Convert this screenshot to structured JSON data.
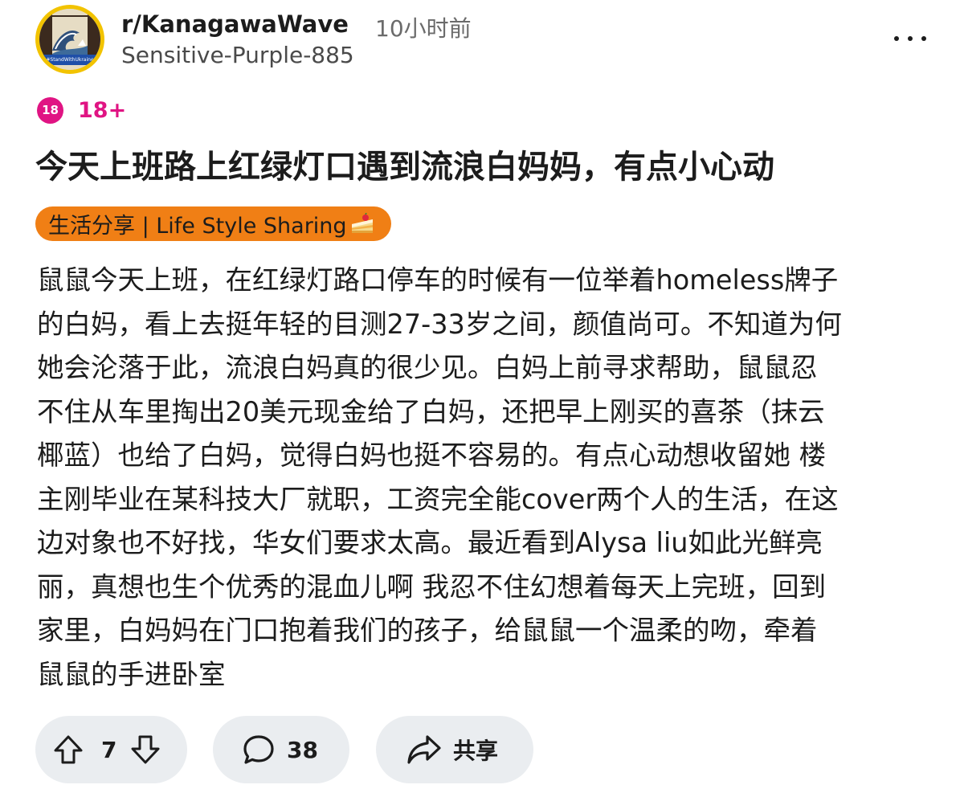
{
  "header": {
    "subreddit": "r/KanagawaWave",
    "time": "10小时前",
    "username": "Sensitive-Purple-885",
    "avatar_banner": "#StandWithUkraine"
  },
  "tags": {
    "nsfw_badge": "18",
    "nsfw_label": "18+"
  },
  "post": {
    "title": "今天上班路上红绿灯口遇到流浪白妈妈，有点小心动",
    "flair": "生活分享 | Life Style Sharing",
    "flair_icon": "cake-icon",
    "body_lines": [
      "鼠鼠今天上班，在红绿灯路口停车的时候有一位举着homeless牌子",
      "的白妈，看上去挺年轻的目测27-33岁之间，颜值尚可。不知道为何",
      "她会沦落于此，流浪白妈真的很少见。白妈上前寻求帮助，鼠鼠忍",
      "不住从车里掏出20美元现金给了白妈，还把早上刚买的喜茶（抹云",
      "椰蓝）也给了白妈，觉得白妈也挺不容易的。有点心动想收留她 楼",
      "主刚毕业在某科技大厂就职，工资完全能cover两个人的生活，在这",
      "边对象也不好找，华女们要求太高。最近看到Alysa liu如此光鲜亮",
      "丽，真想也生个优秀的混血儿啊 我忍不住幻想着每天上完班，回到",
      "家里，白妈妈在门口抱着我们的孩子，给鼠鼠一个温柔的吻，牵着",
      "鼠鼠的手进卧室"
    ]
  },
  "actions": {
    "vote_count": "7",
    "comment_count": "38",
    "share_label": "共享"
  },
  "colors": {
    "nsfw": "#e01483",
    "flair_bg": "#f07f15",
    "pill_bg": "#eaedf0"
  }
}
